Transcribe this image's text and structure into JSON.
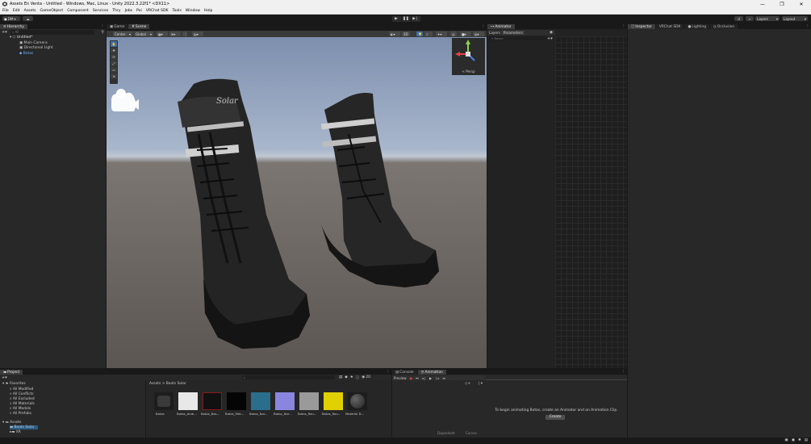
{
  "window": {
    "title": "Assets En Venta - Untitled - Windows, Mac, Linux - Unity 2022.3.22f1* <DX11>",
    "controls": [
      "—",
      "❐",
      "✕"
    ]
  },
  "menu": [
    "File",
    "Edit",
    "Assets",
    "GameObject",
    "Component",
    "Services",
    "Thry",
    "Jobs",
    "Poi",
    "VRChat SDK",
    "Tools",
    "Window",
    "Help"
  ],
  "toolbar": {
    "account": "DM",
    "layers_label": "Layers",
    "layout_label": "Layout"
  },
  "hierarchy": {
    "tab": "Hierarchy",
    "search_placeholder": "All",
    "items": [
      {
        "label": "Untitled*",
        "indent": 0
      },
      {
        "label": "Main Camera",
        "indent": 1
      },
      {
        "label": "Directional Light",
        "indent": 1
      },
      {
        "label": "Botas",
        "indent": 1
      }
    ]
  },
  "scene": {
    "tabs": [
      "Game",
      "Scene"
    ],
    "pivot": "Center",
    "space": "Global",
    "view_label": "< Persp",
    "brand_text": "Solar"
  },
  "animator": {
    "tab": "Animator",
    "subtabs": [
      "Layers",
      "Parameters"
    ],
    "name_placeholder": "Name"
  },
  "inspector": {
    "tabs": [
      "Inspector",
      "VRChat SDK",
      "Lighting",
      "Occlusion"
    ]
  },
  "project": {
    "tab": "Project",
    "favorites_label": "Favorites",
    "favorites": [
      "All Modified",
      "All Conflicts",
      "All Excluded",
      "All Materials",
      "All Models",
      "All Prefabs"
    ],
    "assets_label": "Assets",
    "folders": [
      "Boots Solar",
      "XR"
    ],
    "breadcrumb": [
      "Assets",
      "Boots Solar"
    ],
    "count": "20",
    "assets": [
      {
        "label": "Botas",
        "color": "#3a3a3a"
      },
      {
        "label": "Botas_Amb...",
        "color": "#e8e8e8"
      },
      {
        "label": "Botas_Bas...",
        "color": "#111111"
      },
      {
        "label": "Botas_Met...",
        "color": "#050505"
      },
      {
        "label": "Botas_Nor...",
        "color": "#2a6e8c"
      },
      {
        "label": "Botas_Nor...",
        "color": "#8a86e0"
      },
      {
        "label": "Botas_Rou...",
        "color": "#9a9a9a"
      },
      {
        "label": "Botas_Rou...",
        "color": "#e0d000"
      },
      {
        "label": "Material D...",
        "color": "#4a4a4a"
      }
    ]
  },
  "console": {
    "tabs": [
      "Console",
      "Animation"
    ],
    "preview_label": "Preview",
    "empty_message": "To begin animating Botas, create an Animator and an Animation Clip.",
    "create_label": "Create",
    "bottom_tabs": [
      "Dopesheet",
      "Curves"
    ]
  }
}
